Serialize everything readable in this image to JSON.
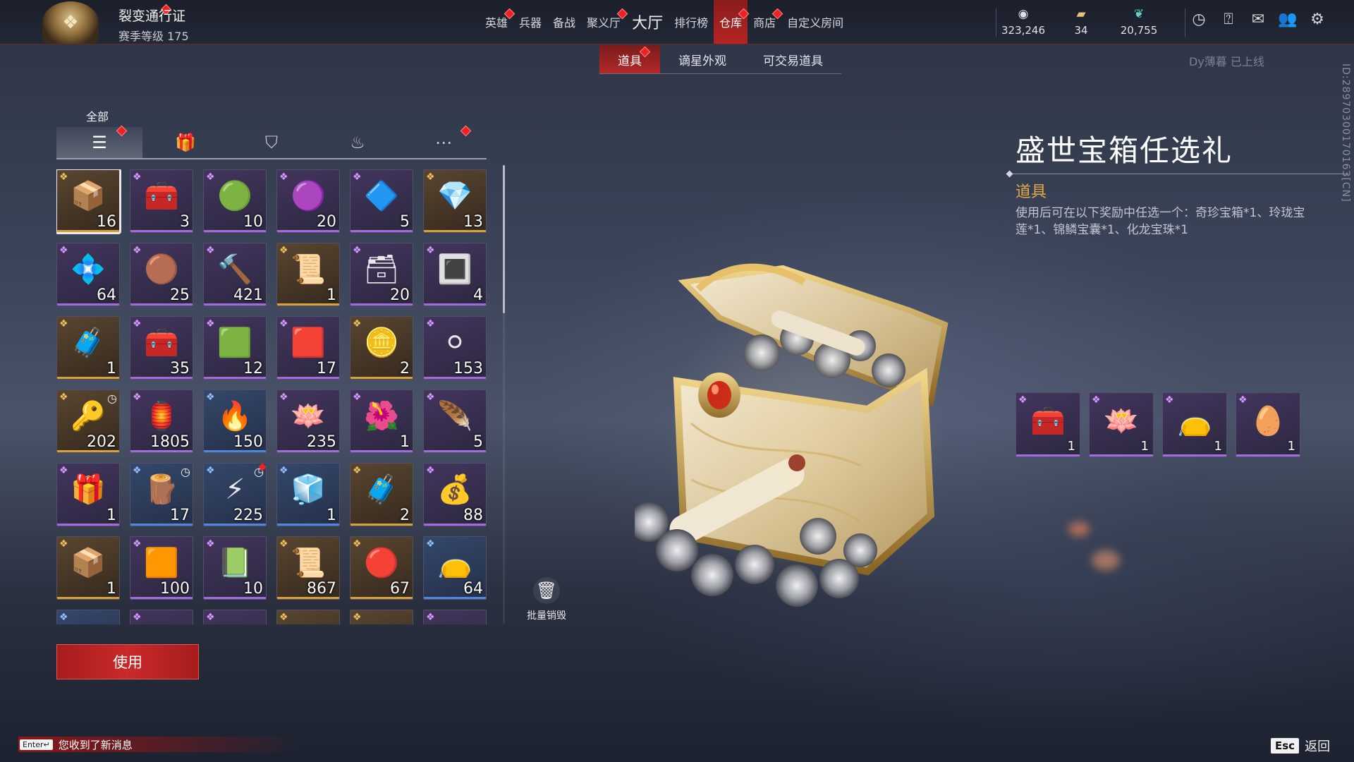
{
  "header": {
    "pass_title": "裂变通行证",
    "season_level": "赛季等级 175",
    "nav": [
      {
        "label": "英雄",
        "dot": true
      },
      {
        "label": "兵器",
        "dot": false
      },
      {
        "label": "备战",
        "dot": false
      },
      {
        "label": "聚义厅",
        "dot": true
      },
      {
        "label": "大厅",
        "dot": false
      },
      {
        "label": "排行榜",
        "dot": false
      },
      {
        "label": "仓库",
        "dot": true,
        "active": true
      },
      {
        "label": "商店",
        "dot": true
      },
      {
        "label": "自定义房间",
        "dot": false
      }
    ],
    "currencies": [
      {
        "icon": "coin-icon",
        "value": "323,246"
      },
      {
        "icon": "ticket-icon",
        "value": "34"
      },
      {
        "icon": "feather-icon",
        "value": "20,755"
      }
    ],
    "icons": [
      "clock-icon",
      "help-icon",
      "mail-icon",
      "friends-icon",
      "gear-icon"
    ]
  },
  "subtabs": [
    {
      "label": "道具",
      "active": true,
      "dot": true
    },
    {
      "label": "谪星外观",
      "active": false,
      "dot": false
    },
    {
      "label": "可交易道具",
      "active": false,
      "dot": false
    }
  ],
  "online_note": "Dy薄暮 已上线",
  "side_id": "ID:2897030017016З[CN]",
  "categories": {
    "label": "全部",
    "tabs": [
      {
        "icon": "layers-icon",
        "active": true,
        "dot": true
      },
      {
        "icon": "gift-icon",
        "active": false,
        "dot": false
      },
      {
        "icon": "badge-icon",
        "active": false,
        "dot": false
      },
      {
        "icon": "flame-icon",
        "active": false,
        "dot": false
      },
      {
        "icon": "more-icon",
        "active": false,
        "dot": true
      }
    ]
  },
  "items": [
    {
      "qty": "16",
      "rarity": "gold",
      "glyph": "📦",
      "selected": true
    },
    {
      "qty": "3",
      "rarity": "purple",
      "glyph": "🧰"
    },
    {
      "qty": "10",
      "rarity": "purple",
      "glyph": "🟢"
    },
    {
      "qty": "20",
      "rarity": "purple",
      "glyph": "🟣"
    },
    {
      "qty": "5",
      "rarity": "purple",
      "glyph": "🔷"
    },
    {
      "qty": "13",
      "rarity": "gold",
      "glyph": "💎"
    },
    {
      "qty": "64",
      "rarity": "purple",
      "glyph": "💠"
    },
    {
      "qty": "25",
      "rarity": "purple",
      "glyph": "🟤"
    },
    {
      "qty": "421",
      "rarity": "purple",
      "glyph": "🔨"
    },
    {
      "qty": "1",
      "rarity": "gold",
      "glyph": "📜"
    },
    {
      "qty": "20",
      "rarity": "purple",
      "glyph": "🗃"
    },
    {
      "qty": "4",
      "rarity": "purple",
      "glyph": "🔳"
    },
    {
      "qty": "1",
      "rarity": "gold",
      "glyph": "🧳"
    },
    {
      "qty": "35",
      "rarity": "purple",
      "glyph": "🧰"
    },
    {
      "qty": "12",
      "rarity": "purple",
      "glyph": "🟩"
    },
    {
      "qty": "17",
      "rarity": "purple",
      "glyph": "🟥"
    },
    {
      "qty": "2",
      "rarity": "gold",
      "glyph": "🪙"
    },
    {
      "qty": "153",
      "rarity": "purple",
      "glyph": "⚪"
    },
    {
      "qty": "202",
      "rarity": "gold",
      "glyph": "🔑",
      "clock": true
    },
    {
      "qty": "1805",
      "rarity": "purple",
      "glyph": "🏮"
    },
    {
      "qty": "150",
      "rarity": "blue",
      "glyph": "🔥"
    },
    {
      "qty": "235",
      "rarity": "purple",
      "glyph": "🪷"
    },
    {
      "qty": "1",
      "rarity": "purple",
      "glyph": "🌺"
    },
    {
      "qty": "5",
      "rarity": "purple",
      "glyph": "🪶"
    },
    {
      "qty": "1",
      "rarity": "purple",
      "glyph": "🎁"
    },
    {
      "qty": "17",
      "rarity": "blue",
      "glyph": "🪵",
      "clock": true
    },
    {
      "qty": "225",
      "rarity": "blue",
      "glyph": "⚡",
      "clock": true,
      "dot": true
    },
    {
      "qty": "1",
      "rarity": "blue",
      "glyph": "🧊"
    },
    {
      "qty": "2",
      "rarity": "gold",
      "glyph": "🧳"
    },
    {
      "qty": "88",
      "rarity": "purple",
      "glyph": "💰"
    },
    {
      "qty": "1",
      "rarity": "gold",
      "glyph": "📦"
    },
    {
      "qty": "100",
      "rarity": "purple",
      "glyph": "🟧"
    },
    {
      "qty": "10",
      "rarity": "purple",
      "glyph": "📗"
    },
    {
      "qty": "867",
      "rarity": "gold",
      "glyph": "📜"
    },
    {
      "qty": "67",
      "rarity": "gold",
      "glyph": "🔴"
    },
    {
      "qty": "64",
      "rarity": "blue",
      "glyph": "👝"
    },
    {
      "qty": "",
      "rarity": "blue",
      "glyph": ""
    },
    {
      "qty": "",
      "rarity": "purple",
      "glyph": ""
    },
    {
      "qty": "",
      "rarity": "purple",
      "glyph": ""
    },
    {
      "qty": "",
      "rarity": "gold",
      "glyph": ""
    },
    {
      "qty": "",
      "rarity": "gold",
      "glyph": ""
    },
    {
      "qty": "",
      "rarity": "purple",
      "glyph": ""
    }
  ],
  "bulk_destroy": "批量销毁",
  "use_button": "使用",
  "detail": {
    "title": "盛世宝箱任选礼",
    "type": "道具",
    "description": "使用后可在以下奖励中任选一个：奇珍宝箱*1、玲珑宝莲*1、锦鳞宝囊*1、化龙宝珠*1",
    "rewards": [
      {
        "glyph": "🧰",
        "qty": "1"
      },
      {
        "glyph": "🪷",
        "qty": "1"
      },
      {
        "glyph": "👝",
        "qty": "1"
      },
      {
        "glyph": "🥚",
        "qty": "1"
      }
    ]
  },
  "footer": {
    "enter_key": "Enter↵",
    "chat_message": "您收到了新消息",
    "esc_key": "Esc",
    "back_label": "返回"
  },
  "colors": {
    "accent_red": "#b52424",
    "rarity_purple": "#a468e0",
    "rarity_gold": "#d9a236",
    "rarity_blue": "#4f86e0",
    "type_label": "#e2a94a"
  }
}
